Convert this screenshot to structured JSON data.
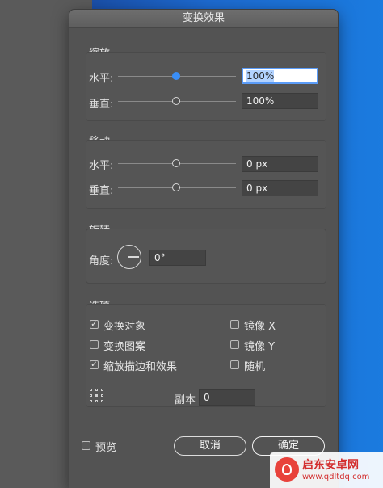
{
  "dialog": {
    "title": "变换效果"
  },
  "scale": {
    "title": "缩放",
    "horizontal_label": "水平:",
    "horizontal_value": "100%",
    "vertical_label": "垂直:",
    "vertical_value": "100%"
  },
  "move": {
    "title": "移动",
    "horizontal_label": "水平:",
    "horizontal_value": "0 px",
    "vertical_label": "垂直:",
    "vertical_value": "0 px"
  },
  "rotate": {
    "title": "旋转",
    "angle_label": "角度:",
    "angle_value": "0°"
  },
  "options": {
    "title": "选项",
    "transform_objects": {
      "label": "变换对象",
      "checked": true
    },
    "transform_patterns": {
      "label": "变换图案",
      "checked": false
    },
    "scale_strokes": {
      "label": "缩放描边和效果",
      "checked": true
    },
    "reflect_x": {
      "label": "镜像 X",
      "checked": false
    },
    "reflect_y": {
      "label": "镜像 Y",
      "checked": false
    },
    "random": {
      "label": "随机",
      "checked": false
    },
    "copies_label": "副本",
    "copies_value": "0"
  },
  "footer": {
    "preview_label": "预览",
    "preview_checked": false,
    "cancel_label": "取消",
    "ok_label": "确定"
  },
  "watermark": {
    "line1": "启东安卓网",
    "line2": "www.qdltdq.com"
  },
  "colors": {
    "accent": "#3a8ef6",
    "dialog_bg": "#535353",
    "desktop_blue": "#1b7bdf"
  }
}
